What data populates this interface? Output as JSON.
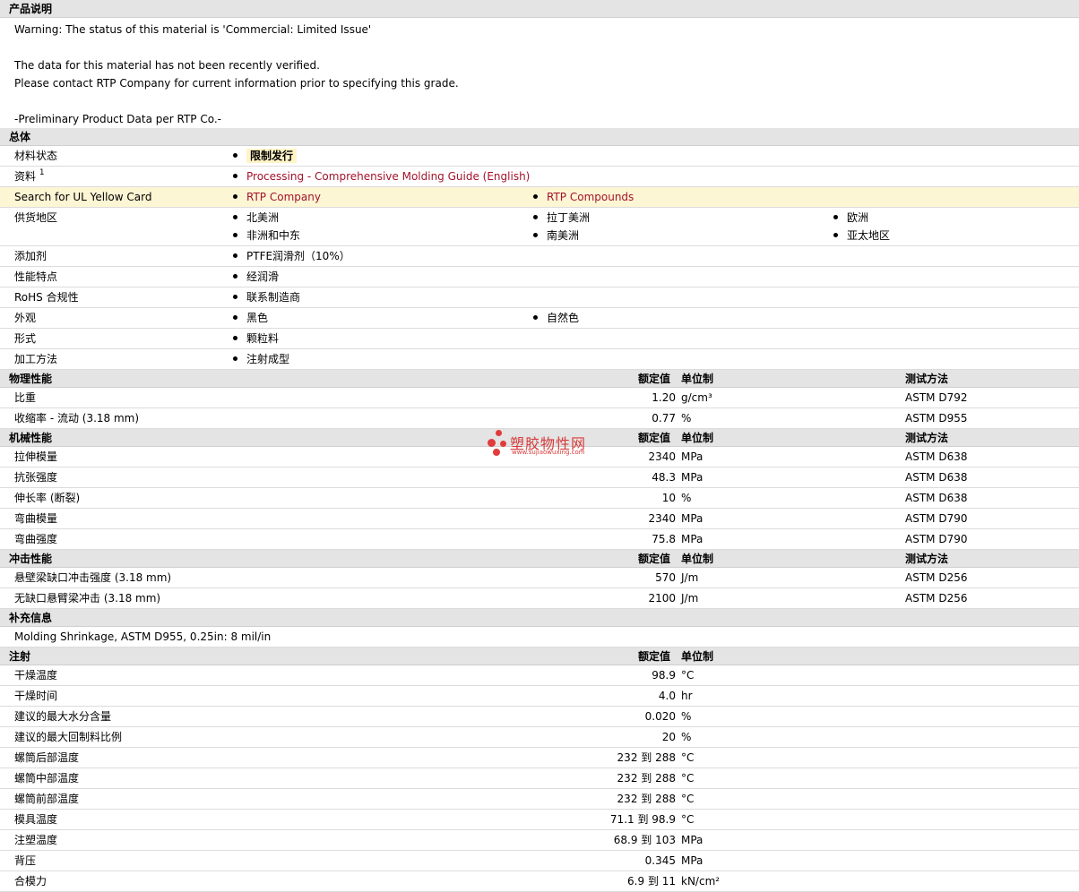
{
  "desc": {
    "title": "产品说明",
    "lines": [
      "Warning: The status of this material is 'Commercial: Limited Issue'",
      "",
      "The data for this material has not been recently verified.",
      "Please contact RTP Company for current information prior to specifying this grade.",
      "",
      "-Preliminary Product Data per RTP Co.-"
    ]
  },
  "general": {
    "title": "总体",
    "status_label": "材料状态",
    "status_value": "限制发行",
    "docs_label": "资料",
    "docs_sup": "1",
    "docs_link": "Processing - Comprehensive Molding Guide (English)",
    "ul_label": "Search for UL Yellow Card",
    "ul_links": [
      "RTP Company",
      "RTP Compounds"
    ],
    "region_label": "供货地区",
    "regions": [
      "北美洲",
      "拉丁美洲",
      "欧洲",
      "非洲和中东",
      "南美洲",
      "亚太地区"
    ],
    "additive_label": "添加剂",
    "additive_value": "PTFE润滑剂（10%）",
    "feature_label": "性能特点",
    "feature_value": "经润滑",
    "rohs_label": "RoHS 合规性",
    "rohs_value": "联系制造商",
    "appearance_label": "外观",
    "appearance_values": [
      "黑色",
      "自然色"
    ],
    "form_label": "形式",
    "form_value": "颗粒料",
    "process_label": "加工方法",
    "process_value": "注射成型"
  },
  "headers": {
    "value": "额定值",
    "unit": "单位制",
    "method": "测试方法"
  },
  "physical": {
    "title": "物理性能",
    "rows": [
      {
        "name": "比重",
        "value": "1.20",
        "unit": "g/cm³",
        "method": "ASTM D792"
      },
      {
        "name": "收缩率 - 流动 (3.18 mm)",
        "value": "0.77",
        "unit": "%",
        "method": "ASTM D955"
      }
    ]
  },
  "mechanical": {
    "title": "机械性能",
    "rows": [
      {
        "name": "拉伸模量",
        "value": "2340",
        "unit": "MPa",
        "method": "ASTM D638"
      },
      {
        "name": "抗张强度",
        "value": "48.3",
        "unit": "MPa",
        "method": "ASTM D638"
      },
      {
        "name": "伸长率 (断裂)",
        "value": "10",
        "unit": "%",
        "method": "ASTM D638"
      },
      {
        "name": "弯曲模量",
        "value": "2340",
        "unit": "MPa",
        "method": "ASTM D790"
      },
      {
        "name": "弯曲强度",
        "value": "75.8",
        "unit": "MPa",
        "method": "ASTM D790"
      }
    ]
  },
  "impact": {
    "title": "冲击性能",
    "rows": [
      {
        "name": "悬壁梁缺口冲击强度 (3.18 mm)",
        "value": "570",
        "unit": "J/m",
        "method": "ASTM D256"
      },
      {
        "name": "无缺口悬臂梁冲击 (3.18 mm)",
        "value": "2100",
        "unit": "J/m",
        "method": "ASTM D256"
      }
    ]
  },
  "supplement": {
    "title": "补充信息",
    "text": "Molding Shrinkage, ASTM D955, 0.25in: 8 mil/in"
  },
  "injection": {
    "title": "注射",
    "rows": [
      {
        "name": "干燥温度",
        "value": "98.9",
        "unit": "°C"
      },
      {
        "name": "干燥时间",
        "value": "4.0",
        "unit": "hr"
      },
      {
        "name": "建议的最大水分含量",
        "value": "0.020",
        "unit": "%"
      },
      {
        "name": "建议的最大回制料比例",
        "value": "20",
        "unit": "%"
      },
      {
        "name": "螺筒后部温度",
        "value": "232 到  288",
        "unit": "°C"
      },
      {
        "name": "螺筒中部温度",
        "value": "232 到  288",
        "unit": "°C"
      },
      {
        "name": "螺筒前部温度",
        "value": "232 到  288",
        "unit": "°C"
      },
      {
        "name": "模具温度",
        "value": "71.1 到  98.9",
        "unit": "°C"
      },
      {
        "name": "注塑温度",
        "value": "68.9 到  103",
        "unit": "MPa"
      },
      {
        "name": "背压",
        "value": "0.345",
        "unit": "MPa"
      },
      {
        "name": "合模力",
        "value": "6.9 到  11",
        "unit": "kN/cm²"
      }
    ]
  },
  "watermark": {
    "title": "塑胶物性网",
    "url": "www.sujiaowuxing.com"
  }
}
